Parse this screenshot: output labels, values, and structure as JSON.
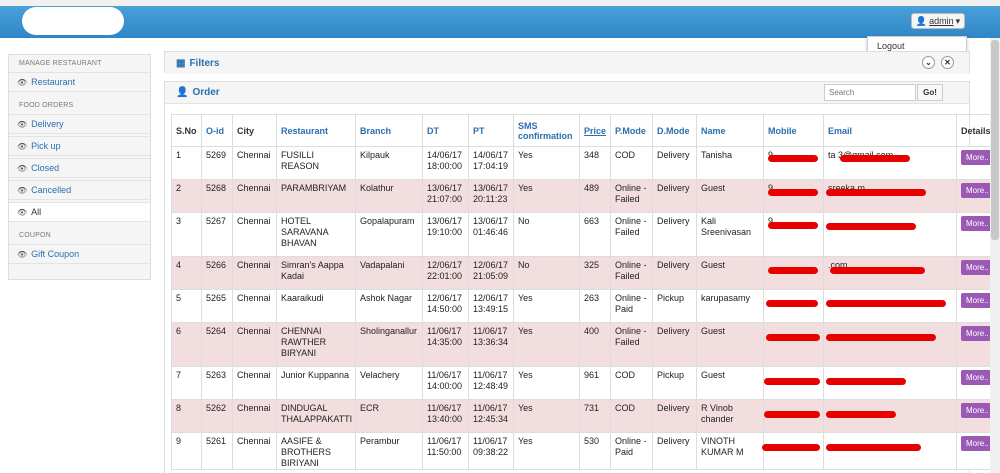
{
  "topbar": {
    "admin_label": "admin",
    "dropdown_logout": "Logout"
  },
  "sidebar": {
    "sections": [
      {
        "heading": "MANAGE RESTAURANT",
        "items": [
          {
            "label": "Restaurant",
            "icon": "eye-icon"
          }
        ]
      },
      {
        "heading": "FOOD ORDERS",
        "items": [
          {
            "label": "Delivery",
            "icon": "eye-icon"
          },
          {
            "label": "Pick up",
            "icon": "eye-icon"
          },
          {
            "label": "Closed",
            "icon": "eye-icon"
          },
          {
            "label": "Cancelled",
            "icon": "eye-icon"
          },
          {
            "label": "All",
            "icon": "eye-icon"
          }
        ]
      },
      {
        "heading": "COUPON",
        "items": [
          {
            "label": "Gift Coupon",
            "icon": "eye-icon"
          }
        ]
      }
    ]
  },
  "filters": {
    "title": "Filters"
  },
  "order": {
    "title": "Order",
    "search_placeholder": "Search",
    "go_label": "Go!"
  },
  "table": {
    "headers": [
      "S.No",
      "O-id",
      "City",
      "Restaurant",
      "Branch",
      "DT",
      "PT",
      "SMS confirmation",
      "Price",
      "P.Mode",
      "D.Mode",
      "Name",
      "Mobile",
      "Email",
      "Details"
    ],
    "rows": [
      {
        "sno": "1",
        "oid": "5269",
        "city": "Chennai",
        "restaurant": "FUSILLI REASON",
        "branch": "Kilpauk",
        "dt": "14/06/17 18:00:00",
        "pt": "14/06/17 17:04:19",
        "sms": "Yes",
        "price": "348",
        "pmode": "COD",
        "dmode": "Delivery",
        "name": "Tanisha",
        "mobile": "9",
        "email": "ta                3@gmail.com",
        "details": "More.."
      },
      {
        "sno": "2",
        "oid": "5268",
        "city": "Chennai",
        "restaurant": "PARAMBRIYAM",
        "branch": "Kolathur",
        "dt": "13/06/17 21:07:00",
        "pt": "13/06/17 20:11:23",
        "sms": "Yes",
        "price": "489",
        "pmode": "Online - Failed",
        "dmode": "Delivery",
        "name": "Guest",
        "mobile": "9",
        "email": "sreeka                m",
        "details": "More.."
      },
      {
        "sno": "3",
        "oid": "5267",
        "city": "Chennai",
        "restaurant": "HOTEL SARAVANA BHAVAN",
        "branch": "Gopalapuram",
        "dt": "13/06/17 19:10:00",
        "pt": "13/06/17 01:46:46",
        "sms": "No",
        "price": "663",
        "pmode": "Online - Failed",
        "dmode": "Delivery",
        "name": "Kali Sreenivasan",
        "mobile": "9",
        "email": "",
        "details": "More.."
      },
      {
        "sno": "4",
        "oid": "5266",
        "city": "Chennai",
        "restaurant": "Simran's Aappa Kadai",
        "branch": "Vadapalani",
        "dt": "12/06/17 22:01:00",
        "pt": "12/06/17 21:05:09",
        "sms": "No",
        "price": "325",
        "pmode": "Online - Failed",
        "dmode": "Delivery",
        "name": "Guest",
        "mobile": "",
        "email": "                .com",
        "details": "More.."
      },
      {
        "sno": "5",
        "oid": "5265",
        "city": "Chennai",
        "restaurant": "Kaaraikudi",
        "branch": "Ashok Nagar",
        "dt": "12/06/17 14:50:00",
        "pt": "12/06/17 13:49:15",
        "sms": "Yes",
        "price": "263",
        "pmode": "Online - Paid",
        "dmode": "Pickup",
        "name": "karupasamy",
        "mobile": "",
        "email": "",
        "details": "More.."
      },
      {
        "sno": "6",
        "oid": "5264",
        "city": "Chennai",
        "restaurant": "CHENNAI RAWTHER BIRYANI",
        "branch": "Sholinganallur",
        "dt": "11/06/17 14:35:00",
        "pt": "11/06/17 13:36:34",
        "sms": "Yes",
        "price": "400",
        "pmode": "Online - Failed",
        "dmode": "Delivery",
        "name": "Guest",
        "mobile": "",
        "email": "",
        "details": "More.."
      },
      {
        "sno": "7",
        "oid": "5263",
        "city": "Chennai",
        "restaurant": "Junior Kuppanna",
        "branch": "Velachery",
        "dt": "11/06/17 14:00:00",
        "pt": "11/06/17 12:48:49",
        "sms": "Yes",
        "price": "961",
        "pmode": "COD",
        "dmode": "Pickup",
        "name": "Guest",
        "mobile": "",
        "email": "",
        "details": "More.."
      },
      {
        "sno": "8",
        "oid": "5262",
        "city": "Chennai",
        "restaurant": "DINDUGAL THALAPPAKATTI",
        "branch": "ECR",
        "dt": "11/06/17 13:40:00",
        "pt": "11/06/17 12:45:34",
        "sms": "Yes",
        "price": "731",
        "pmode": "COD",
        "dmode": "Delivery",
        "name": "R Vinob chander",
        "mobile": "",
        "email": "",
        "details": "More.."
      },
      {
        "sno": "9",
        "oid": "5261",
        "city": "Chennai",
        "restaurant": "AASIFE & BROTHERS BIRIYANI",
        "branch": "Perambur",
        "dt": "11/06/17 11:50:00",
        "pt": "11/06/17 09:38:22",
        "sms": "Yes",
        "price": "530",
        "pmode": "Online - Paid",
        "dmode": "Delivery",
        "name": "VINOTH KUMAR M",
        "mobile": "",
        "email": "",
        "details": "More.."
      }
    ]
  },
  "colors": {
    "topbar": "#3a92d0",
    "link": "#2a6fb0",
    "row_alt": "#f2dede",
    "more_button": "#9b59b6",
    "redaction": "#e60000"
  }
}
